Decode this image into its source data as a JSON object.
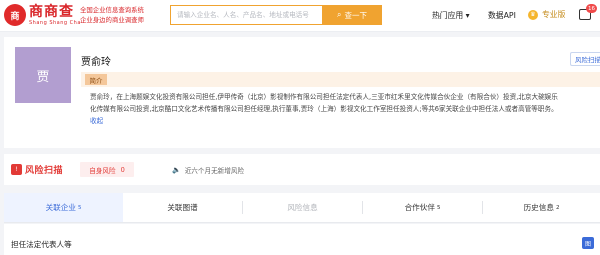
{
  "header": {
    "logo_mark": "商",
    "logo_text": "商商查",
    "logo_pinyin": "Shang Shang Cha",
    "slogan_line1": "全国企业信息查询系统",
    "slogan_line2": "企业身边的商业调查师",
    "search_placeholder": "请输入企业名、人名、产品名、地址或电话号",
    "search_button": "查一下",
    "nav_apps": "热门应用",
    "nav_api": "数据API",
    "nav_pro": "专业版",
    "msg_count": "16",
    "colors": {
      "brand_red": "#d9262a",
      "search_orange": "#f0a330",
      "accent_blue": "#3b6bd8"
    }
  },
  "profile": {
    "avatar_char": "贾",
    "name": "贾俞玲",
    "risk_button": "风险扫描",
    "intro_tag": "简介",
    "intro_lines": [
      "贾俞玲，在上海题娱文化投资有限公司担任,伊甲传奇（北京）影视制作有限公司担任法定代表人,三亚市红禾里文化传媒合伙企业（有限合伙）投资,北京大碗娱乐",
      "化传媒有限公司投资,北京酷口文化艺术传播有限公司担任经理,执行董事,贾玲（上海）影视文化工作室担任投资人;等共6家关联企业中担任法人或者高管等职务。"
    ],
    "collapse_label": "收起"
  },
  "risk_scan": {
    "title": "风险扫描",
    "self_risk_label": "自身风险",
    "self_risk_count": "0",
    "no_new_risk": "近六个月无新增风险"
  },
  "tabs": [
    {
      "label": "关联企业",
      "count": "5",
      "state": "active"
    },
    {
      "label": "关联图谱",
      "count": "",
      "state": "normal"
    },
    {
      "label": "风险信息",
      "count": "",
      "state": "disabled"
    },
    {
      "label": "合作伙伴",
      "count": "5",
      "state": "normal"
    },
    {
      "label": "历史信息",
      "count": "2",
      "state": "normal"
    }
  ],
  "section": {
    "title": "担任法定代表人等",
    "icon_label": "图"
  }
}
